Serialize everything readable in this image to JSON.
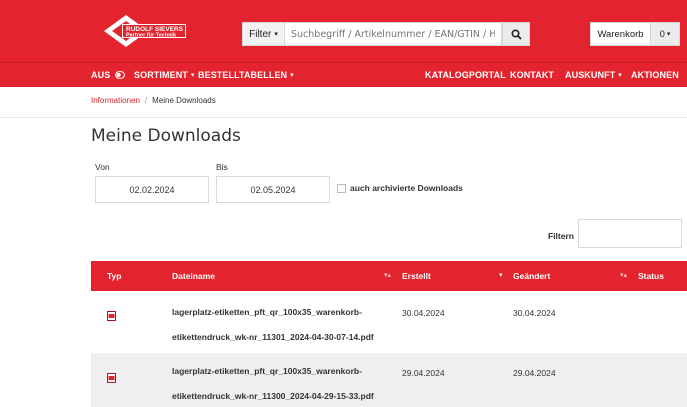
{
  "header": {
    "logo_line1": "RUDOLF SIEVERS",
    "logo_line2": "Partner für Technik",
    "filter_label": "Filter",
    "search_placeholder": "Suchbegriff / Artikelnummer / EAN/GTIN / Hersteller",
    "cart_label": "Warenkorb",
    "cart_count": "0"
  },
  "nav": {
    "aus": "AUS",
    "sortiment": "SORTIMENT",
    "bestelltabellen": "BESTELLTABELLEN",
    "katalogportal": "KATALOGPORTAL",
    "kontakt": "KONTAKT",
    "auskunft": "AUSKUNFT",
    "aktionen": "AKTIONEN"
  },
  "breadcrumb": {
    "parent": "Informationen",
    "separator": "/",
    "current": "Meine Downloads"
  },
  "page_title": "Meine Downloads",
  "dates": {
    "from_label": "Von",
    "from_value": "02.02.2024",
    "to_label": "Bis",
    "to_value": "02.05.2024"
  },
  "archive_label": "auch archivierte Downloads",
  "filter_label": "Filtern",
  "table": {
    "headers": {
      "typ": "Typ",
      "dateiname": "Dateiname",
      "erstellt": "Erstellt",
      "geaendert": "Geändert",
      "status": "Status"
    },
    "rows": [
      {
        "type_icon": "pdf-icon",
        "name_line1": "lagerplatz-etiketten_pft_qr_100x35_warenkorb-",
        "name_line2": "etikettendruck_wk-nr_11301_2024-04-30-07-14.pdf",
        "created": "30.04.2024",
        "modified": "30.04.2024",
        "status": ""
      },
      {
        "type_icon": "pdf-icon",
        "name_line1": "lagerplatz-etiketten_pft_qr_100x35_warenkorb-",
        "name_line2": "etikettendruck_wk-nr_11300_2024-04-29-15-33.pdf",
        "created": "29.04.2024",
        "modified": "29.04.2024",
        "status": ""
      }
    ]
  },
  "colors": {
    "brand_red": "#e3232d",
    "row_alt": "#efefef"
  }
}
